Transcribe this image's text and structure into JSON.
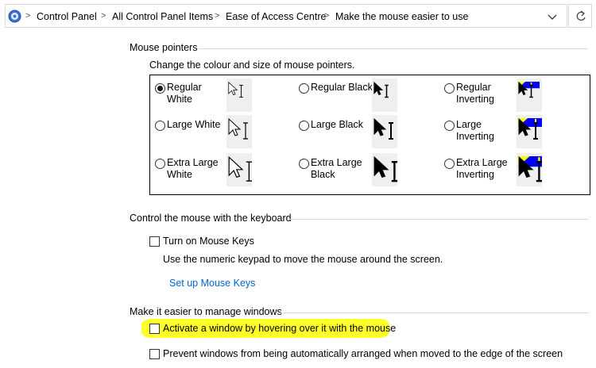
{
  "address_bar": {
    "crumbs": [
      "Control Panel",
      "All Control Panel Items",
      "Ease of Access Centre",
      "Make the mouse easier to use"
    ]
  },
  "mouse_pointers": {
    "heading": "Mouse pointers",
    "description": "Change the colour and size of mouse pointers.",
    "options": [
      {
        "label": "Regular\nWhite",
        "selected": true,
        "scheme": "white",
        "size": "regular"
      },
      {
        "label": "Regular Black",
        "selected": false,
        "scheme": "black",
        "size": "regular"
      },
      {
        "label": "Regular\nInverting",
        "selected": false,
        "scheme": "inverting",
        "size": "regular"
      },
      {
        "label": "Large White",
        "selected": false,
        "scheme": "white",
        "size": "large"
      },
      {
        "label": "Large Black",
        "selected": false,
        "scheme": "black",
        "size": "large"
      },
      {
        "label": "Large\nInverting",
        "selected": false,
        "scheme": "inverting",
        "size": "large"
      },
      {
        "label": "Extra Large\nWhite",
        "selected": false,
        "scheme": "white",
        "size": "extra-large"
      },
      {
        "label": "Extra Large\nBlack",
        "selected": false,
        "scheme": "black",
        "size": "extra-large"
      },
      {
        "label": "Extra Large\nInverting",
        "selected": false,
        "scheme": "inverting",
        "size": "extra-large"
      }
    ]
  },
  "keyboard": {
    "heading": "Control the mouse with the keyboard",
    "mouse_keys_label": "Turn on Mouse Keys",
    "mouse_keys_checked": false,
    "mouse_keys_description": "Use the numeric keypad to move the mouse around the screen.",
    "setup_link": "Set up Mouse Keys"
  },
  "windows": {
    "heading": "Make it easier to manage windows",
    "hover_label": "Activate a window by hovering over it with the mouse",
    "hover_checked": false,
    "prevent_arrange_label": "Prevent windows from being automatically arranged when moved to the edge of the screen",
    "prevent_arrange_checked": false
  },
  "colors": {
    "link": "#0066cc",
    "highlight": "#ffff2a",
    "inverting_blue": "#0000ff",
    "inverting_yellow": "#ffff00"
  }
}
